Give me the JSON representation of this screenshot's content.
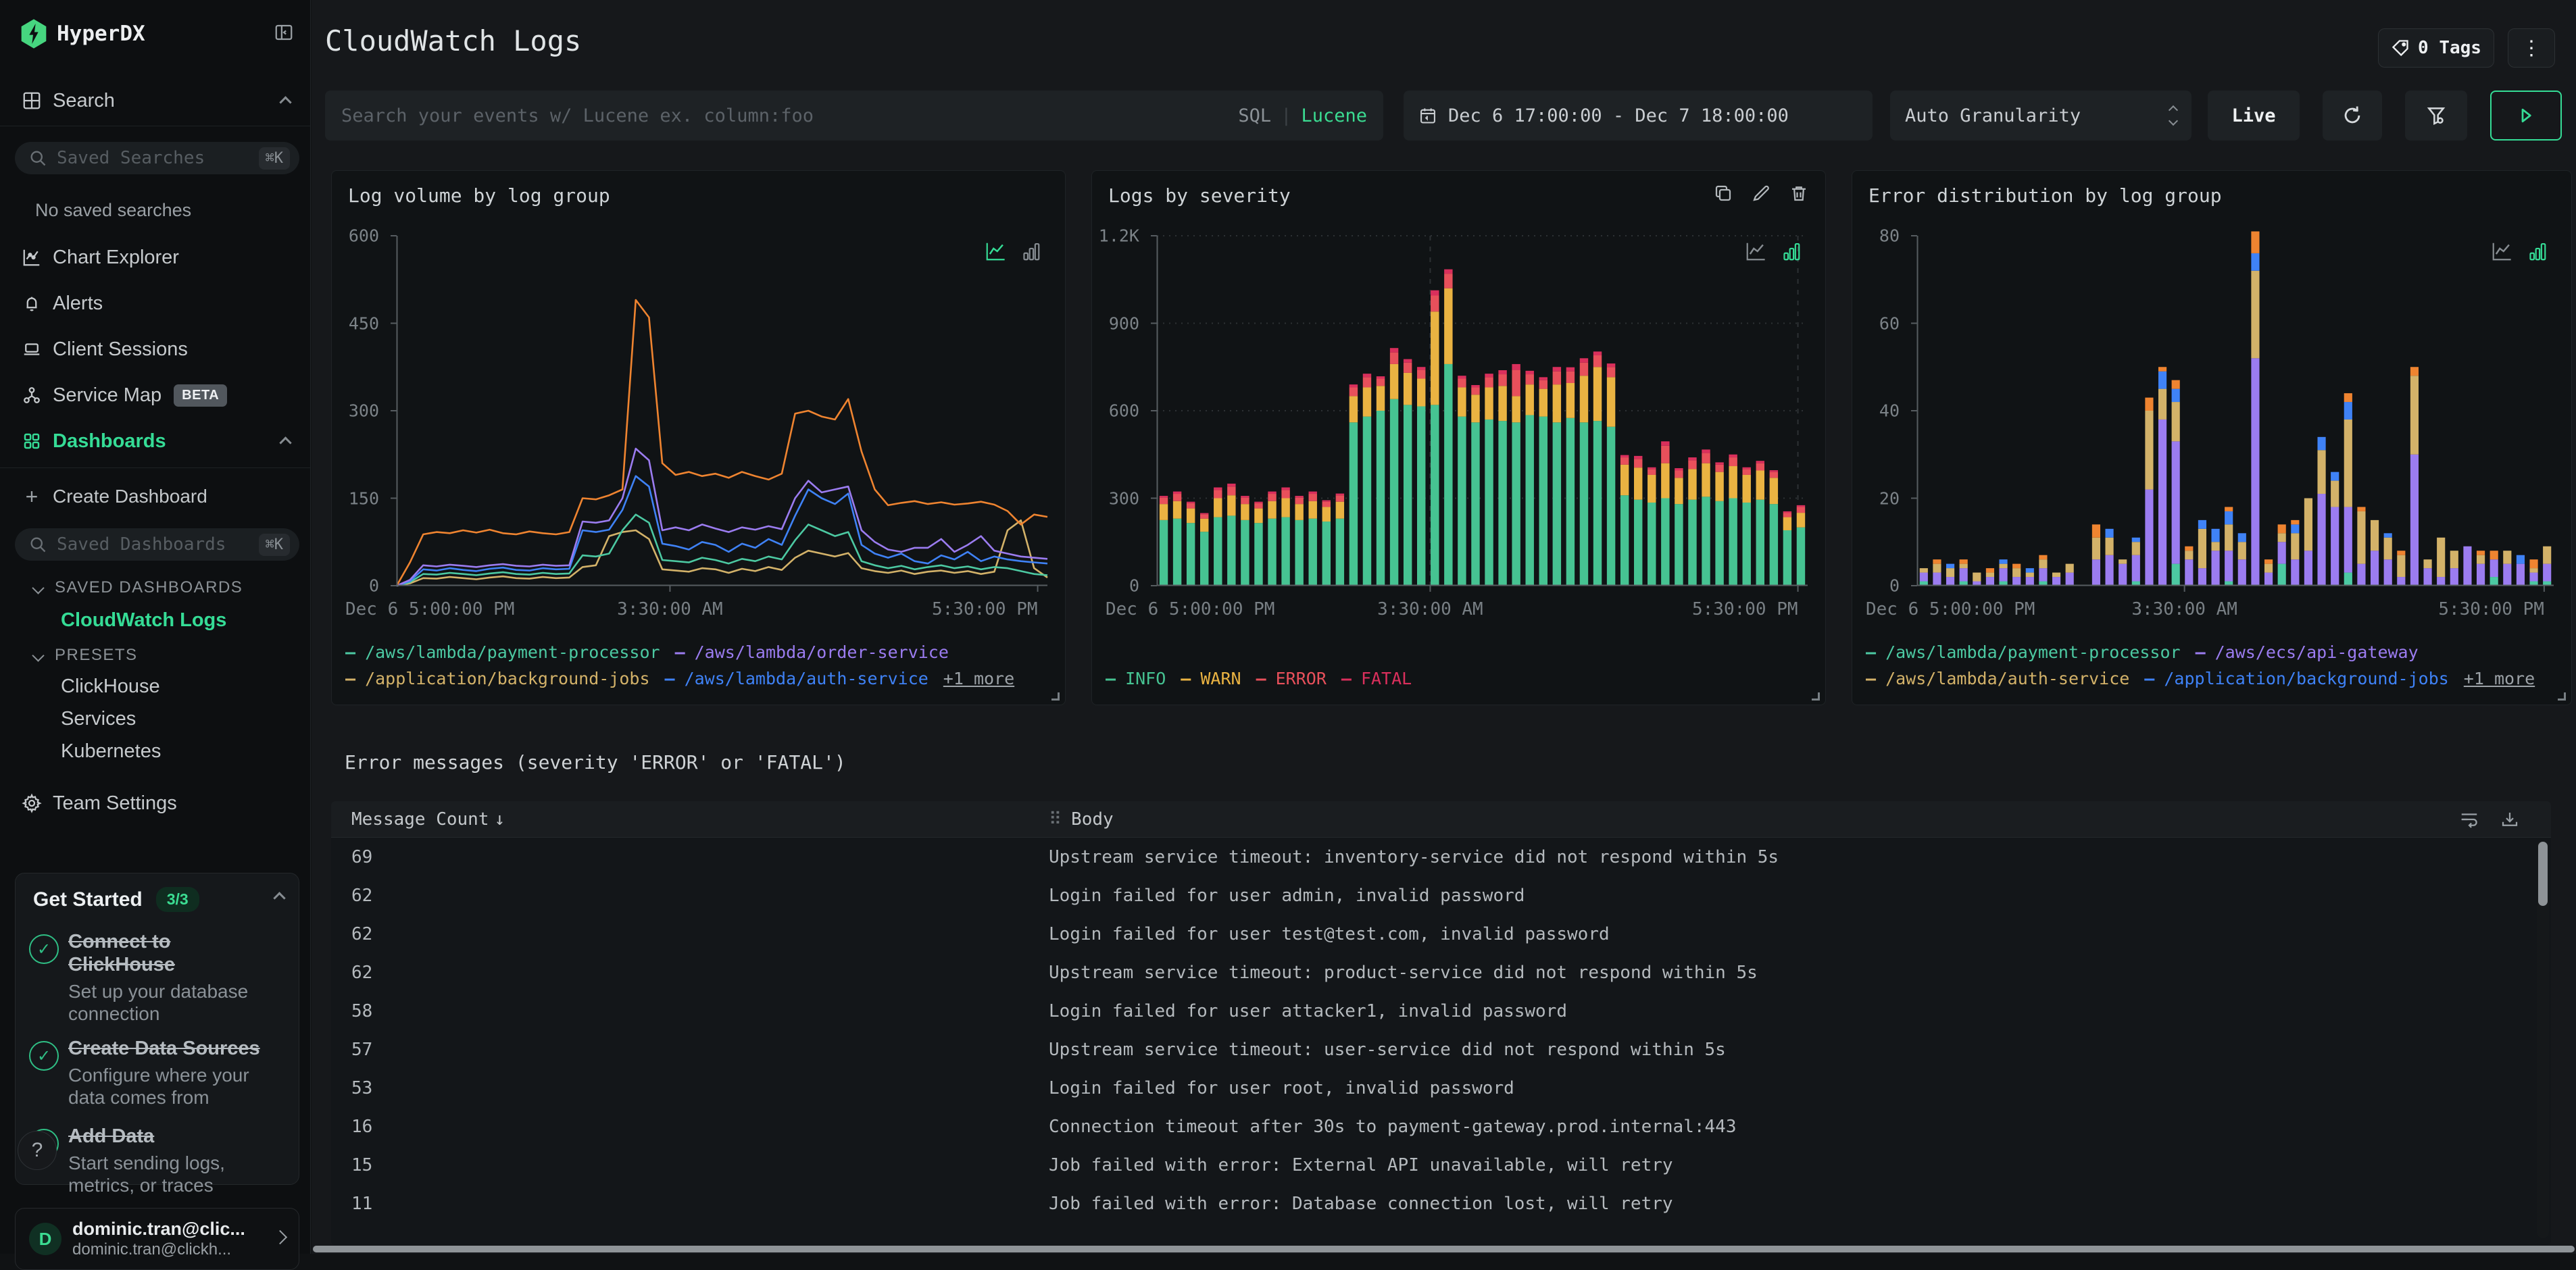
{
  "sidebar": {
    "logo_text": "HyperDX",
    "search_label": "Search",
    "saved_searches_placeholder": "Saved Searches",
    "kbd": "⌘K",
    "no_saved": "No saved searches",
    "items": [
      "Chart Explorer",
      "Alerts",
      "Client Sessions",
      "Service Map",
      "Dashboards"
    ],
    "beta": "BETA",
    "create_dashboard": "Create Dashboard",
    "plus": "+",
    "saved_dashboards_placeholder": "Saved Dashboards",
    "saved_dashboards_header": "SAVED DASHBOARDS",
    "saved_dashboard_active": "CloudWatch Logs",
    "presets_header": "PRESETS",
    "presets": [
      "ClickHouse",
      "Services",
      "Kubernetes"
    ],
    "team_settings": "Team Settings",
    "get_started": {
      "title": "Get Started",
      "badge": "3/3",
      "steps": [
        {
          "title": "Connect to ClickHouse",
          "desc": "Set up your database connection"
        },
        {
          "title": "Create Data Sources",
          "desc": "Configure where your data comes from"
        },
        {
          "title": "Add Data",
          "desc": "Start sending logs, metrics, or traces"
        }
      ],
      "check": "✓"
    },
    "help": "?",
    "user": {
      "initial": "D",
      "name": "dominic.tran@clic...",
      "email": "dominic.tran@clickh..."
    }
  },
  "header": {
    "title": "CloudWatch Logs",
    "tags_label": "0 Tags",
    "dots": "⋮"
  },
  "controls": {
    "search_placeholder": "Search your events w/ Lucene ex. column:foo",
    "sql": "SQL",
    "divider": "|",
    "lucene": "Lucene",
    "date_range": "Dec 6 17:00:00 - Dec 7 18:00:00",
    "granularity": "Auto Granularity",
    "live": "Live"
  },
  "table": {
    "title": "Error messages (severity 'ERROR' or 'FATAL')",
    "col_count": "Message Count",
    "sort_icon": "↓",
    "col_body": "Body",
    "drag_icon": "⠿",
    "rows": [
      {
        "count": "69",
        "body": "Upstream service timeout: inventory-service did not respond within 5s"
      },
      {
        "count": "62",
        "body": "Login failed for user admin, invalid password"
      },
      {
        "count": "62",
        "body": "Login failed for user test@test.com, invalid password"
      },
      {
        "count": "62",
        "body": "Upstream service timeout: product-service did not respond within 5s"
      },
      {
        "count": "58",
        "body": "Login failed for user attacker1, invalid password"
      },
      {
        "count": "57",
        "body": "Upstream service timeout: user-service did not respond within 5s"
      },
      {
        "count": "53",
        "body": "Login failed for user root, invalid password"
      },
      {
        "count": "16",
        "body": "Connection timeout after 30s to payment-gateway.prod.internal:443"
      },
      {
        "count": "15",
        "body": "Job failed with error: External API unavailable, will retry"
      },
      {
        "count": "11",
        "body": "Job failed with error: Database connection lost, will retry"
      }
    ]
  },
  "chart_data": [
    {
      "type": "line",
      "title": "Log volume by log group",
      "ylim": [
        0,
        600
      ],
      "yticks": [
        0,
        150,
        300,
        450,
        600
      ],
      "ytick_labels": [
        "0",
        "150",
        "300",
        "450",
        "600"
      ],
      "grid_h": false,
      "grid_v": [],
      "bottom_ticks": [
        0.42,
        0.985
      ],
      "x_labels": [
        {
          "text": "Dec 6 5:00:00 PM",
          "pos": 0,
          "anchor": "start"
        },
        {
          "text": "3:30:00 AM",
          "pos": 0.42,
          "anchor": "middle"
        },
        {
          "text": "5:30:00 PM",
          "pos": 0.985,
          "anchor": "end"
        }
      ],
      "active_mode": "line",
      "series": [
        {
          "name": "/application/background-jobs",
          "color": "#d3b269",
          "values": [
            0,
            4,
            13,
            12,
            15,
            13,
            11,
            14,
            16,
            13,
            12,
            15,
            13,
            14,
            32,
            35,
            85,
            92,
            95,
            80,
            28,
            26,
            24,
            30,
            28,
            22,
            29,
            25,
            32,
            27,
            48,
            60,
            55,
            50,
            56,
            30,
            25,
            22,
            26,
            20,
            24,
            26,
            22,
            25,
            20,
            24,
            95,
            112,
            30,
            14
          ]
        },
        {
          "name": "/aws/lambda/payment-processor",
          "color": "#4cc9a2",
          "values": [
            0,
            6,
            20,
            19,
            22,
            20,
            18,
            21,
            23,
            20,
            19,
            22,
            20,
            21,
            52,
            50,
            55,
            95,
            122,
            108,
            44,
            42,
            40,
            48,
            44,
            38,
            46,
            42,
            50,
            45,
            78,
            105,
            95,
            85,
            92,
            42,
            35,
            30,
            34,
            28,
            32,
            35,
            30,
            33,
            28,
            32,
            30,
            25,
            20,
            18
          ]
        },
        {
          "name": "/aws/lambda/auth-service",
          "color": "#3f82f6",
          "values": [
            0,
            8,
            28,
            26,
            30,
            27,
            25,
            29,
            31,
            27,
            26,
            30,
            28,
            29,
            95,
            92,
            96,
            130,
            188,
            170,
            72,
            68,
            62,
            75,
            70,
            58,
            72,
            65,
            80,
            70,
            120,
            165,
            150,
            140,
            158,
            70,
            55,
            48,
            55,
            42,
            38,
            52,
            45,
            58,
            42,
            50,
            45,
            42,
            40,
            38
          ]
        },
        {
          "name": "/aws/lambda/order-service",
          "color": "#9b7cf0",
          "values": [
            0,
            10,
            35,
            33,
            36,
            34,
            32,
            35,
            37,
            34,
            33,
            36,
            34,
            35,
            110,
            108,
            112,
            150,
            235,
            215,
            95,
            100,
            95,
            105,
            98,
            92,
            100,
            96,
            102,
            97,
            150,
            180,
            160,
            165,
            170,
            95,
            75,
            62,
            58,
            65,
            65,
            80,
            58,
            70,
            85,
            60,
            55,
            50,
            48,
            46
          ]
        },
        {
          "name": "(+1 more)",
          "color": "#ef8430",
          "values": [
            0,
            40,
            88,
            92,
            90,
            95,
            91,
            96,
            90,
            88,
            93,
            90,
            88,
            92,
            150,
            148,
            155,
            165,
            490,
            460,
            210,
            190,
            195,
            188,
            192,
            185,
            195,
            188,
            182,
            192,
            295,
            300,
            290,
            285,
            320,
            230,
            165,
            138,
            142,
            145,
            140,
            143,
            139,
            141,
            144,
            139,
            128,
            105,
            122,
            118
          ]
        }
      ],
      "legend_rows": [
        [
          {
            "label": "/aws/lambda/payment-processor",
            "color": "#4cc9a2"
          },
          {
            "label": "/aws/lambda/order-service",
            "color": "#9b7cf0"
          }
        ],
        [
          {
            "label": "/application/background-jobs",
            "color": "#d3b269"
          },
          {
            "label": "/aws/lambda/auth-service",
            "color": "#3f82f6"
          },
          {
            "label": "+1 more",
            "color": "#9ba1a6",
            "more": true
          }
        ]
      ]
    },
    {
      "type": "stacked_bar",
      "title": "Logs by severity",
      "ylim": [
        0,
        1200
      ],
      "yticks": [
        0,
        300,
        600,
        900,
        1200
      ],
      "ytick_labels": [
        "0",
        "300",
        "600",
        "900",
        "1.2K"
      ],
      "grid_h": true,
      "grid_v": [
        0.42,
        0.985
      ],
      "bottom_ticks": [
        0.42,
        0.985
      ],
      "x_labels": [
        {
          "text": "Dec 6 5:00:00 PM",
          "pos": 0,
          "anchor": "start"
        },
        {
          "text": "3:30:00 AM",
          "pos": 0.42,
          "anchor": "middle"
        },
        {
          "text": "5:30:00 PM",
          "pos": 0.985,
          "anchor": "end"
        }
      ],
      "active_mode": "bar",
      "series": [
        {
          "name": "INFO",
          "color": "#46c392",
          "values": [
            225,
            230,
            215,
            185,
            235,
            240,
            225,
            215,
            230,
            235,
            225,
            230,
            220,
            230,
            560,
            580,
            600,
            640,
            620,
            615,
            620,
            760,
            580,
            560,
            570,
            565,
            560,
            585,
            580,
            560,
            575,
            560,
            565,
            545,
            310,
            295,
            285,
            300,
            280,
            295,
            305,
            290,
            300,
            285,
            295,
            280,
            190,
            200
          ]
        },
        {
          "name": "WARN",
          "color": "#eab342",
          "values": [
            55,
            60,
            50,
            45,
            65,
            70,
            55,
            50,
            60,
            65,
            55,
            60,
            50,
            58,
            90,
            100,
            85,
            120,
            110,
            95,
            320,
            260,
            100,
            95,
            110,
            120,
            90,
            105,
            95,
            130,
            120,
            160,
            185,
            170,
            105,
            110,
            95,
            120,
            90,
            105,
            115,
            100,
            110,
            95,
            100,
            90,
            45,
            50
          ]
        },
        {
          "name": "ERROR",
          "color": "#e8505b",
          "values": [
            22,
            25,
            18,
            15,
            28,
            30,
            22,
            18,
            25,
            28,
            22,
            25,
            18,
            22,
            30,
            35,
            25,
            40,
            35,
            30,
            55,
            50,
            30,
            25,
            35,
            40,
            90,
            35,
            30,
            45,
            40,
            45,
            40,
            35,
            25,
            30,
            20,
            60,
            25,
            30,
            35,
            25,
            30,
            20,
            25,
            20,
            15,
            20
          ]
        },
        {
          "name": "FATAL",
          "color": "#da2f5c",
          "values": [
            6,
            8,
            5,
            4,
            9,
            10,
            6,
            5,
            8,
            9,
            6,
            8,
            5,
            6,
            10,
            12,
            8,
            15,
            12,
            10,
            18,
            15,
            10,
            8,
            12,
            14,
            20,
            12,
            10,
            15,
            14,
            15,
            13,
            12,
            8,
            10,
            6,
            15,
            8,
            10,
            12,
            8,
            10,
            6,
            8,
            6,
            5,
            6
          ]
        }
      ],
      "legend_rows": [
        [
          {
            "label": "INFO",
            "color": "#46c392"
          },
          {
            "label": "WARN",
            "color": "#eab342"
          },
          {
            "label": "ERROR",
            "color": "#e8505b"
          },
          {
            "label": "FATAL",
            "color": "#da2f5c"
          }
        ]
      ]
    },
    {
      "type": "stacked_bar",
      "title": "Error distribution by log group",
      "ylim": [
        0,
        80
      ],
      "yticks": [
        0,
        20,
        40,
        60,
        80
      ],
      "ytick_labels": [
        "0",
        "20",
        "40",
        "60",
        "80"
      ],
      "grid_h": false,
      "grid_v": [],
      "bottom_ticks": [
        0.42,
        0.985
      ],
      "x_labels": [
        {
          "text": "Dec 6 5:00:00 PM",
          "pos": 0,
          "anchor": "start"
        },
        {
          "text": "3:30:00 AM",
          "pos": 0.42,
          "anchor": "middle"
        },
        {
          "text": "5:30:00 PM",
          "pos": 0.985,
          "anchor": "end"
        }
      ],
      "active_mode": "bar",
      "series": [
        {
          "name": "/aws/lambda/payment-processor",
          "color": "#4cc9a2",
          "values": [
            1,
            0,
            0,
            1,
            0,
            0,
            1,
            0,
            0,
            1,
            0,
            0,
            0,
            0,
            0,
            0,
            1,
            0,
            0,
            5,
            0,
            0,
            0,
            1,
            0,
            0,
            0,
            5,
            0,
            0,
            0,
            0,
            3,
            0,
            0,
            0,
            0,
            0,
            0,
            0,
            0,
            0,
            0,
            2,
            0,
            0,
            1,
            1
          ]
        },
        {
          "name": "/aws/ecs/api-gateway",
          "color": "#9b7cf0",
          "values": [
            2,
            3,
            2,
            3,
            1,
            2,
            3,
            2,
            2,
            3,
            2,
            3,
            0,
            6,
            7,
            5,
            6,
            22,
            38,
            28,
            6,
            4,
            8,
            7,
            6,
            52,
            3,
            5,
            6,
            8,
            21,
            18,
            15,
            5,
            8,
            6,
            2,
            30,
            4,
            2,
            4,
            9,
            5,
            4,
            5,
            5,
            2,
            4
          ]
        },
        {
          "name": "/aws/lambda/auth-service",
          "color": "#d3b269",
          "values": [
            1,
            2,
            2,
            1,
            2,
            1,
            1,
            2,
            1,
            2,
            1,
            2,
            0,
            5,
            4,
            1,
            3,
            18,
            7,
            9,
            2,
            9,
            2,
            6,
            4,
            20,
            2,
            2,
            6,
            12,
            10,
            6,
            20,
            12,
            7,
            5,
            5,
            18,
            2,
            9,
            4,
            0,
            2,
            0,
            3,
            0,
            1,
            4
          ]
        },
        {
          "name": "/application/background-jobs",
          "color": "#3f82f6",
          "values": [
            0,
            0,
            1,
            0,
            0,
            0,
            1,
            0,
            1,
            0,
            0,
            0,
            0,
            0,
            2,
            0,
            1,
            0,
            4,
            3,
            0,
            2,
            3,
            3,
            2,
            4,
            0,
            0,
            2,
            0,
            3,
            2,
            4,
            0,
            0,
            1,
            0,
            0,
            0,
            0,
            0,
            0,
            0,
            0,
            0,
            2,
            0,
            0
          ]
        },
        {
          "name": "(+1 more)",
          "color": "#ef8430",
          "values": [
            0,
            1,
            0,
            1,
            0,
            1,
            0,
            1,
            0,
            1,
            0,
            0,
            0,
            3,
            0,
            0,
            0,
            3,
            1,
            2,
            1,
            0,
            0,
            1,
            0,
            5,
            1,
            2,
            1,
            0,
            0,
            0,
            2,
            1,
            0,
            0,
            1,
            2,
            0,
            0,
            0,
            0,
            1,
            2,
            0,
            0,
            2,
            0
          ]
        }
      ],
      "legend_rows": [
        [
          {
            "label": "/aws/lambda/payment-processor",
            "color": "#4cc9a2"
          },
          {
            "label": "/aws/ecs/api-gateway",
            "color": "#9b7cf0"
          }
        ],
        [
          {
            "label": "/aws/lambda/auth-service",
            "color": "#d3b269"
          },
          {
            "label": "/application/background-jobs",
            "color": "#3f82f6"
          },
          {
            "label": "+1 more",
            "color": "#9ba1a6",
            "more": true
          }
        ]
      ]
    }
  ]
}
